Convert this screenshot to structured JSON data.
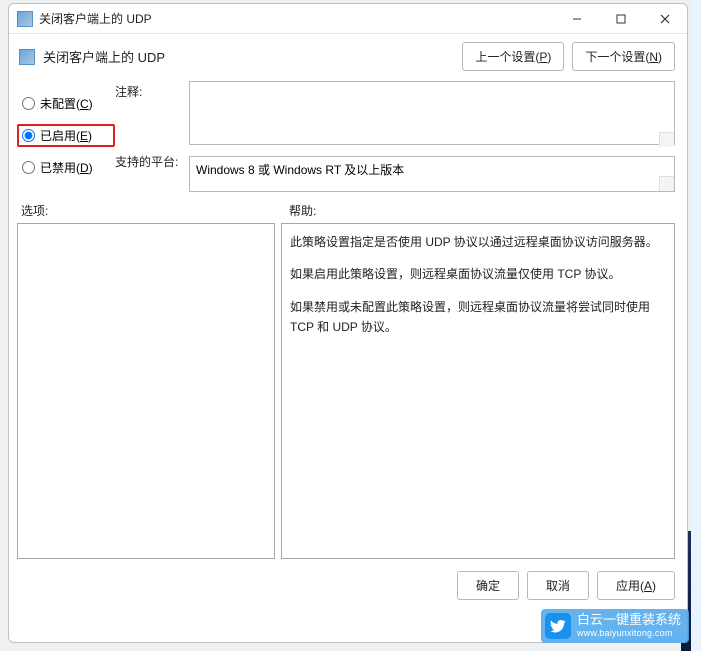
{
  "window": {
    "title": "关闭客户端上的 UDP",
    "heading": "关闭客户端上的 UDP"
  },
  "nav": {
    "prev": "上一个设置(P)",
    "next": "下一个设置(N)"
  },
  "radios": {
    "not_configured": "未配置(C)",
    "enabled": "已启用(E)",
    "disabled": "已禁用(D)"
  },
  "labels": {
    "comment": "注释:",
    "platforms": "支持的平台:",
    "options": "选项:",
    "help": "帮助:"
  },
  "platforms_text": "Windows 8 或 Windows RT 及以上版本",
  "help": {
    "p1": "此策略设置指定是否使用 UDP 协议以通过远程桌面协议访问服务器。",
    "p2": "如果启用此策略设置，则远程桌面协议流量仅使用 TCP 协议。",
    "p3": "如果禁用或未配置此策略设置，则远程桌面协议流量将尝试同时使用 TCP 和 UDP 协议。"
  },
  "buttons": {
    "ok": "确定",
    "cancel": "取消",
    "apply": "应用(A)"
  },
  "watermark": {
    "brand": "白云一键重装系统",
    "url": "www.baiyunxitong.com"
  }
}
